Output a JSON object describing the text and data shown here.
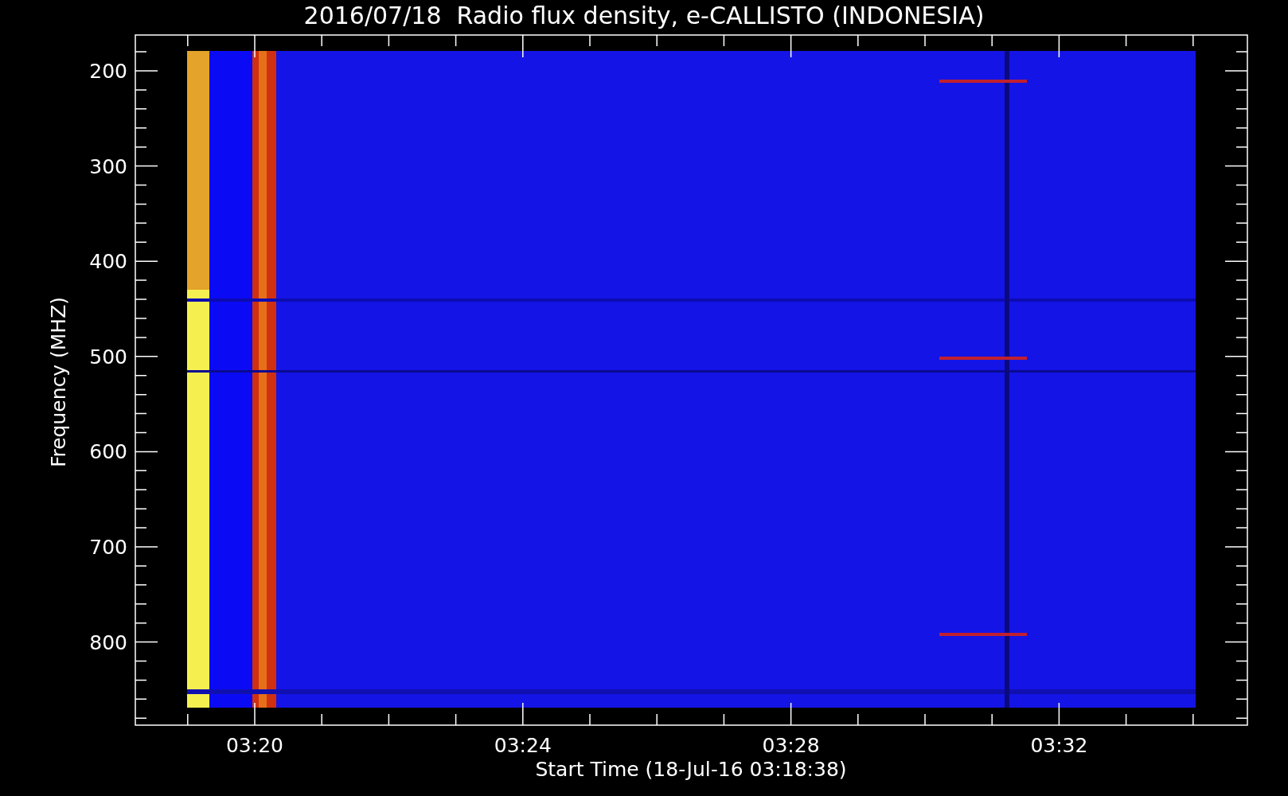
{
  "title": "2016/07/18  Radio flux density, e-CALLISTO (INDONESIA)",
  "y_axis": {
    "label": "Frequency (MHZ)",
    "ticks": [
      "200",
      "300",
      "400",
      "500",
      "600",
      "700",
      "800"
    ]
  },
  "x_axis": {
    "label": "Start Time (18-Jul-16 03:18:38)",
    "ticks": [
      "03:20",
      "03:24",
      "03:28",
      "03:32"
    ]
  }
}
